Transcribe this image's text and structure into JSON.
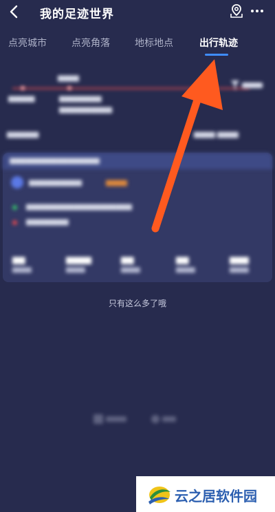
{
  "header": {
    "title": "我的足迹世界",
    "back_icon": "chevron-left-icon",
    "map_icon": "map-pin-icon",
    "more_icon": "more-horizontal-icon"
  },
  "tabs": [
    {
      "label": "点亮城市",
      "active": false
    },
    {
      "label": "点亮角落",
      "active": false
    },
    {
      "label": "地标地点",
      "active": false
    },
    {
      "label": "出行轨迹",
      "active": true
    }
  ],
  "list_end_text": "只有这么多了哦",
  "watermark": {
    "text": "云之居软件园"
  },
  "colors": {
    "background": "#272b4e",
    "accent": "#3f8dff",
    "annotation_arrow": "#ff5a1f"
  }
}
